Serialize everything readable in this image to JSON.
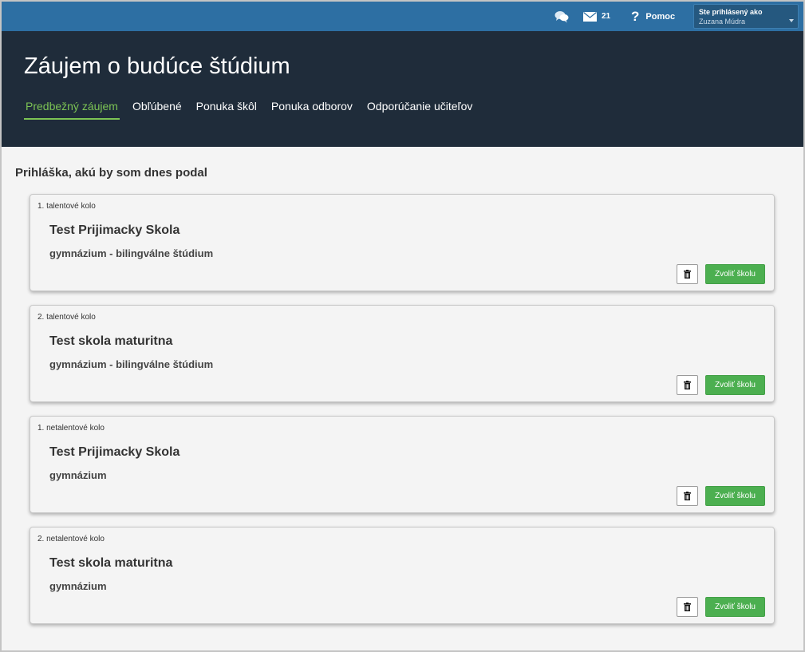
{
  "topbar": {
    "chat_icon": "chat-bubbles-icon",
    "mail_icon": "envelope-icon",
    "mail_count": "21",
    "help_icon": "question-mark-icon",
    "help_label": "Pomoc",
    "user_caption": "Ste prihlásený ako",
    "user_name": "Zuzana Múdra"
  },
  "header": {
    "title": "Záujem o budúce štúdium",
    "nav": [
      {
        "label": "Predbežný záujem",
        "active": true
      },
      {
        "label": "Obľúbené"
      },
      {
        "label": "Ponuka škôl"
      },
      {
        "label": "Ponuka odborov"
      },
      {
        "label": "Odporúčanie učiteľov"
      }
    ]
  },
  "main": {
    "section_title": "Prihláška, akú by som dnes podal",
    "cards": [
      {
        "round": "1. talentové kolo",
        "school": "Test Prijimacky Skola",
        "program": "gymnázium - bilingválne štúdium",
        "choose_label": "Zvoliť školu"
      },
      {
        "round": "2. talentové kolo",
        "school": "Test skola maturitna",
        "program": "gymnázium - bilingválne štúdium",
        "choose_label": "Zvoliť školu"
      },
      {
        "round": "1. netalentové kolo",
        "school": "Test Prijimacky Skola",
        "program": "gymnázium",
        "choose_label": "Zvoliť školu"
      },
      {
        "round": "2. netalentové kolo",
        "school": "Test skola maturitna",
        "program": "gymnázium",
        "choose_label": "Zvoliť školu"
      }
    ]
  },
  "colors": {
    "topbar": "#2d6fa3",
    "header": "#1f2c3a",
    "nav_active": "#7cc354",
    "button_green": "#4caf50"
  }
}
